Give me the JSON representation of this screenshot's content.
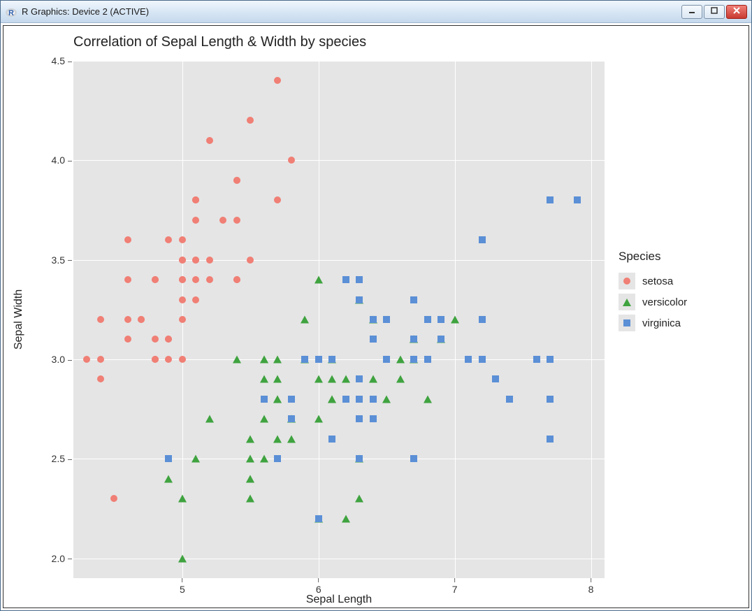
{
  "window": {
    "title": "R Graphics: Device 2 (ACTIVE)",
    "icon_label": "R"
  },
  "chart_data": {
    "type": "scatter",
    "title": "Correlation of Sepal Length & Width by species",
    "xlabel": "Sepal Length",
    "ylabel": "Sepal Width",
    "xlim": [
      4.2,
      8.1
    ],
    "ylim": [
      1.9,
      4.5
    ],
    "x_ticks": [
      5,
      6,
      7,
      8
    ],
    "y_ticks": [
      2.0,
      2.5,
      3.0,
      3.5,
      4.0,
      4.5
    ],
    "legend_title": "Species",
    "series": [
      {
        "name": "setosa",
        "shape": "circle",
        "color": "#f07f75",
        "points": [
          [
            5.1,
            3.5
          ],
          [
            4.9,
            3.0
          ],
          [
            4.7,
            3.2
          ],
          [
            4.6,
            3.1
          ],
          [
            5.0,
            3.6
          ],
          [
            5.4,
            3.9
          ],
          [
            4.6,
            3.4
          ],
          [
            5.0,
            3.4
          ],
          [
            4.4,
            2.9
          ],
          [
            4.9,
            3.1
          ],
          [
            5.4,
            3.7
          ],
          [
            4.8,
            3.4
          ],
          [
            4.8,
            3.0
          ],
          [
            4.3,
            3.0
          ],
          [
            5.8,
            4.0
          ],
          [
            5.7,
            4.4
          ],
          [
            5.4,
            3.9
          ],
          [
            5.1,
            3.5
          ],
          [
            5.7,
            3.8
          ],
          [
            5.1,
            3.8
          ],
          [
            5.4,
            3.4
          ],
          [
            5.1,
            3.7
          ],
          [
            4.6,
            3.6
          ],
          [
            5.1,
            3.3
          ],
          [
            4.8,
            3.4
          ],
          [
            5.0,
            3.0
          ],
          [
            5.0,
            3.4
          ],
          [
            5.2,
            3.5
          ],
          [
            5.2,
            3.4
          ],
          [
            4.7,
            3.2
          ],
          [
            4.8,
            3.1
          ],
          [
            5.4,
            3.4
          ],
          [
            5.2,
            4.1
          ],
          [
            5.5,
            4.2
          ],
          [
            4.9,
            3.1
          ],
          [
            5.0,
            3.2
          ],
          [
            5.5,
            3.5
          ],
          [
            4.9,
            3.6
          ],
          [
            4.4,
            3.0
          ],
          [
            5.1,
            3.4
          ],
          [
            5.0,
            3.5
          ],
          [
            4.5,
            2.3
          ],
          [
            4.4,
            3.2
          ],
          [
            5.0,
            3.5
          ],
          [
            5.1,
            3.8
          ],
          [
            4.8,
            3.0
          ],
          [
            5.1,
            3.8
          ],
          [
            4.6,
            3.2
          ],
          [
            5.3,
            3.7
          ],
          [
            5.0,
            3.3
          ]
        ]
      },
      {
        "name": "versicolor",
        "shape": "triangle",
        "color": "#3fa33f",
        "points": [
          [
            7.0,
            3.2
          ],
          [
            6.4,
            3.2
          ],
          [
            6.9,
            3.1
          ],
          [
            5.5,
            2.3
          ],
          [
            6.5,
            2.8
          ],
          [
            5.7,
            2.8
          ],
          [
            6.3,
            3.3
          ],
          [
            4.9,
            2.4
          ],
          [
            6.6,
            2.9
          ],
          [
            5.2,
            2.7
          ],
          [
            5.0,
            2.0
          ],
          [
            5.9,
            3.0
          ],
          [
            6.0,
            2.2
          ],
          [
            6.1,
            2.9
          ],
          [
            5.6,
            2.9
          ],
          [
            6.7,
            3.1
          ],
          [
            5.6,
            3.0
          ],
          [
            5.8,
            2.7
          ],
          [
            6.2,
            2.2
          ],
          [
            5.6,
            2.5
          ],
          [
            5.9,
            3.2
          ],
          [
            6.1,
            2.8
          ],
          [
            6.3,
            2.5
          ],
          [
            6.1,
            2.8
          ],
          [
            6.4,
            2.9
          ],
          [
            6.6,
            3.0
          ],
          [
            6.8,
            2.8
          ],
          [
            6.7,
            3.0
          ],
          [
            6.0,
            2.9
          ],
          [
            5.7,
            2.6
          ],
          [
            5.5,
            2.4
          ],
          [
            5.5,
            2.4
          ],
          [
            5.8,
            2.7
          ],
          [
            6.0,
            2.7
          ],
          [
            5.4,
            3.0
          ],
          [
            6.0,
            3.4
          ],
          [
            6.7,
            3.1
          ],
          [
            6.3,
            2.3
          ],
          [
            5.6,
            3.0
          ],
          [
            5.5,
            2.5
          ],
          [
            5.5,
            2.6
          ],
          [
            6.1,
            3.0
          ],
          [
            5.8,
            2.6
          ],
          [
            5.0,
            2.3
          ],
          [
            5.6,
            2.7
          ],
          [
            5.7,
            3.0
          ],
          [
            5.7,
            2.9
          ],
          [
            6.2,
            2.9
          ],
          [
            5.1,
            2.5
          ],
          [
            5.7,
            2.8
          ]
        ]
      },
      {
        "name": "virginica",
        "shape": "square",
        "color": "#5b8fd6",
        "points": [
          [
            6.3,
            3.3
          ],
          [
            5.8,
            2.7
          ],
          [
            7.1,
            3.0
          ],
          [
            6.3,
            2.9
          ],
          [
            6.5,
            3.0
          ],
          [
            7.6,
            3.0
          ],
          [
            4.9,
            2.5
          ],
          [
            7.3,
            2.9
          ],
          [
            6.7,
            2.5
          ],
          [
            7.2,
            3.6
          ],
          [
            6.5,
            3.2
          ],
          [
            6.4,
            2.7
          ],
          [
            6.8,
            3.0
          ],
          [
            5.7,
            2.5
          ],
          [
            5.8,
            2.8
          ],
          [
            6.4,
            3.2
          ],
          [
            6.5,
            3.0
          ],
          [
            7.7,
            3.8
          ],
          [
            7.7,
            2.6
          ],
          [
            6.0,
            2.2
          ],
          [
            6.9,
            3.2
          ],
          [
            5.6,
            2.8
          ],
          [
            7.7,
            2.8
          ],
          [
            6.3,
            2.7
          ],
          [
            6.7,
            3.3
          ],
          [
            7.2,
            3.2
          ],
          [
            6.2,
            2.8
          ],
          [
            6.1,
            3.0
          ],
          [
            6.4,
            2.8
          ],
          [
            7.2,
            3.0
          ],
          [
            7.4,
            2.8
          ],
          [
            7.9,
            3.8
          ],
          [
            6.4,
            2.8
          ],
          [
            6.3,
            2.8
          ],
          [
            6.1,
            2.6
          ],
          [
            7.7,
            3.0
          ],
          [
            6.3,
            3.4
          ],
          [
            6.4,
            3.1
          ],
          [
            6.0,
            3.0
          ],
          [
            6.9,
            3.1
          ],
          [
            6.7,
            3.1
          ],
          [
            6.9,
            3.1
          ],
          [
            5.8,
            2.7
          ],
          [
            6.8,
            3.2
          ],
          [
            6.7,
            3.3
          ],
          [
            6.7,
            3.0
          ],
          [
            6.3,
            2.5
          ],
          [
            6.5,
            3.0
          ],
          [
            6.2,
            3.4
          ],
          [
            5.9,
            3.0
          ]
        ]
      }
    ]
  }
}
